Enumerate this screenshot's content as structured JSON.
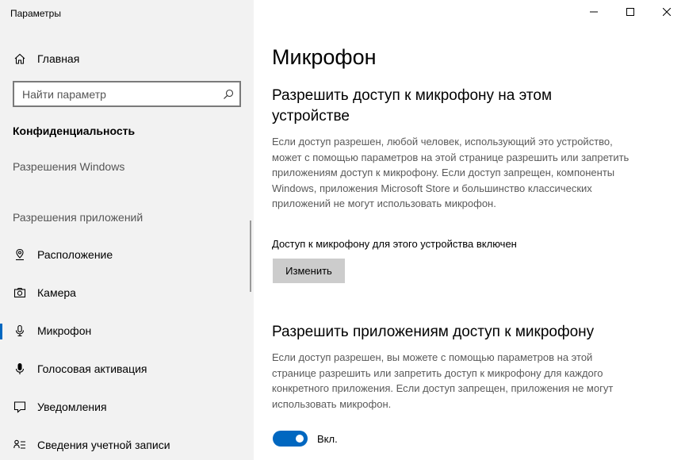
{
  "window": {
    "title": "Параметры"
  },
  "sidebar": {
    "home_label": "Главная",
    "search_placeholder": "Найти параметр",
    "section_title": "Конфиденциальность",
    "group_windows": "Разрешения Windows",
    "group_apps": "Разрешения приложений",
    "items": [
      {
        "label": "Расположение",
        "icon": "location-icon"
      },
      {
        "label": "Камера",
        "icon": "camera-icon"
      },
      {
        "label": "Микрофон",
        "icon": "microphone-icon",
        "active": true
      },
      {
        "label": "Голосовая активация",
        "icon": "voice-activation-icon"
      },
      {
        "label": "Уведомления",
        "icon": "notifications-icon"
      },
      {
        "label": "Сведения учетной записи",
        "icon": "account-info-icon"
      }
    ]
  },
  "main": {
    "title": "Микрофон",
    "device_heading": "Разрешить доступ к микрофону на этом устройстве",
    "device_description": "Если доступ разрешен, любой человек, использующий это устройство, может с помощью параметров на этой странице разрешить или запретить приложениям доступ к микрофону. Если доступ запрещен, компоненты Windows, приложения Microsoft Store и большинство классических приложений не могут использовать микрофон.",
    "device_status": "Доступ к микрофону для этого устройства включен",
    "change_button": "Изменить",
    "apps_heading": "Разрешить приложениям доступ к микрофону",
    "apps_description": "Если доступ разрешен, вы можете с помощью параметров на этой странице разрешить или запретить доступ к микрофону для каждого конкретного приложения. Если доступ запрещен, приложения не могут использовать микрофон.",
    "toggle_state": "Вкл.",
    "toggle_on": true
  },
  "colors": {
    "accent": "#0067c0",
    "sidebar_bg": "#f2f2f2",
    "button_bg": "#cccccc"
  }
}
